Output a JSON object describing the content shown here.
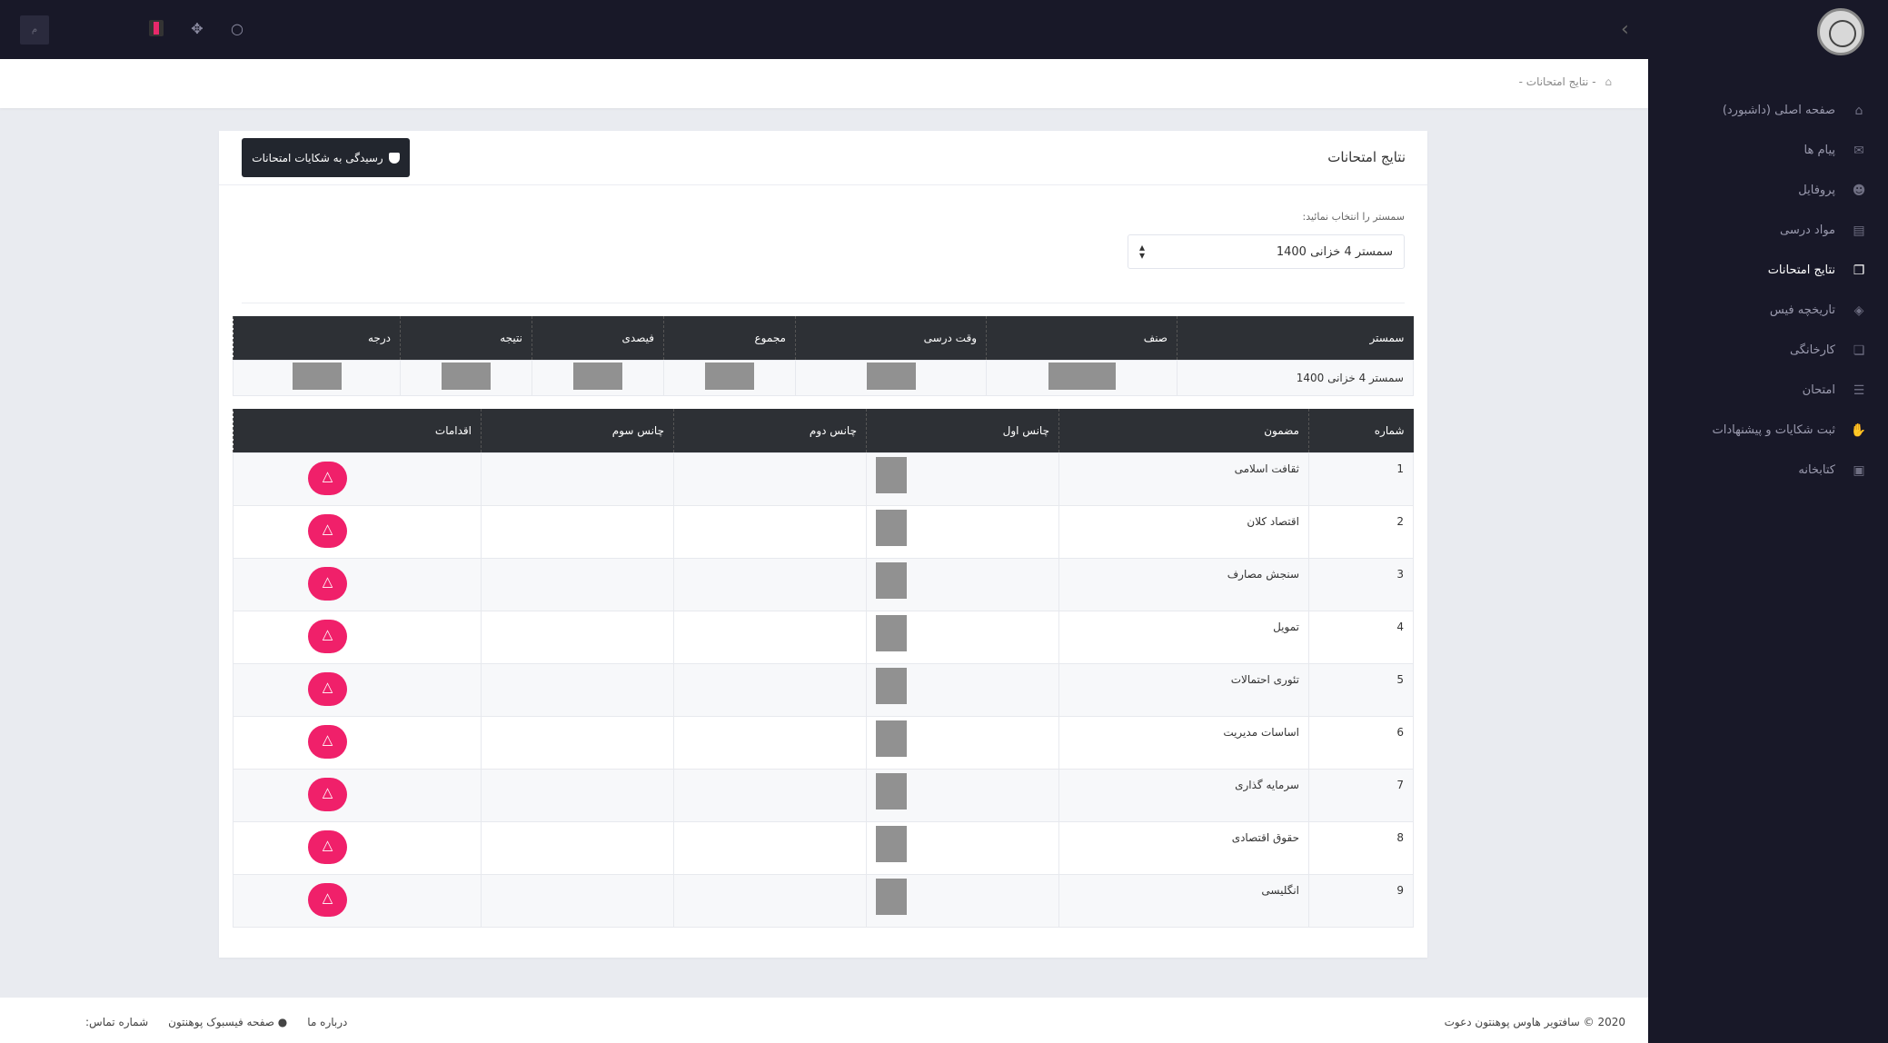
{
  "topbar": {
    "user_initial": "م",
    "search_icon": "search-icon",
    "apps_icon": "apps-icon",
    "flag_icon": "flag-icon"
  },
  "sidebar": {
    "items": [
      {
        "label": "صفحه اصلی (داشبورد)",
        "icon": "⌂",
        "active": false
      },
      {
        "label": "پیام ها",
        "icon": "✉",
        "active": false
      },
      {
        "label": "پروفایل",
        "icon": "☻",
        "active": false
      },
      {
        "label": "مواد درسی",
        "icon": "▤",
        "active": false
      },
      {
        "label": "نتایج امتحانات",
        "icon": "❐",
        "active": true
      },
      {
        "label": "تاریخچه فیس",
        "icon": "◈",
        "active": false
      },
      {
        "label": "کارخانگی",
        "icon": "❏",
        "active": false
      },
      {
        "label": "امتحان",
        "icon": "☰",
        "active": false
      },
      {
        "label": "ثبت شکایات و پیشنهادات",
        "icon": "✋",
        "active": false
      },
      {
        "label": "کتابخانه",
        "icon": "▣",
        "active": false
      }
    ]
  },
  "breadcrumb": {
    "home": "⌂",
    "sep": "-",
    "current": "نتایج امتحانات",
    "tail": "-"
  },
  "card": {
    "title": "نتایج امتحانات",
    "complaint_button": "رسیدگی به شکایات امتحانات"
  },
  "semester_select": {
    "label": "سمستر را انتخاب نمائید:",
    "value": "سمستر 4 خزانی 1400",
    "arrow": "▲▼"
  },
  "summary_table": {
    "headers": [
      "سمستر",
      "صنف",
      "وقت درسی",
      "مجموع",
      "فیصدی",
      "نتیجه",
      "درجه"
    ],
    "row": {
      "semester": "سمستر 4 خزانی 1400"
    }
  },
  "results_table": {
    "headers": [
      "شماره",
      "مضمون",
      "چانس اول",
      "چانس دوم",
      "چانس سوم",
      "اقدامات"
    ],
    "rows": [
      {
        "num": "1",
        "subject": "ثقافت اسلامی"
      },
      {
        "num": "2",
        "subject": "اقتصاد کلان"
      },
      {
        "num": "3",
        "subject": "سنجش مصارف"
      },
      {
        "num": "4",
        "subject": "تمویل"
      },
      {
        "num": "5",
        "subject": "تئوری احتمالات"
      },
      {
        "num": "6",
        "subject": "اساسات مدیریت"
      },
      {
        "num": "7",
        "subject": "سرمایه گذاری"
      },
      {
        "num": "8",
        "subject": "حقوق اقتصادی"
      },
      {
        "num": "9",
        "subject": "انگلیسی"
      }
    ],
    "action_icon": "△"
  },
  "footer": {
    "copyright": "2020 © سافتویر هاوس پوهنتون دعوت",
    "about": "درباره ما",
    "facebook": "صفحه فیسبوک پوهنتون",
    "contact": "شماره تماس:"
  },
  "colors": {
    "sidebar_bg": "#181828",
    "accent": "#f0206a",
    "table_header": "#2d3035"
  }
}
